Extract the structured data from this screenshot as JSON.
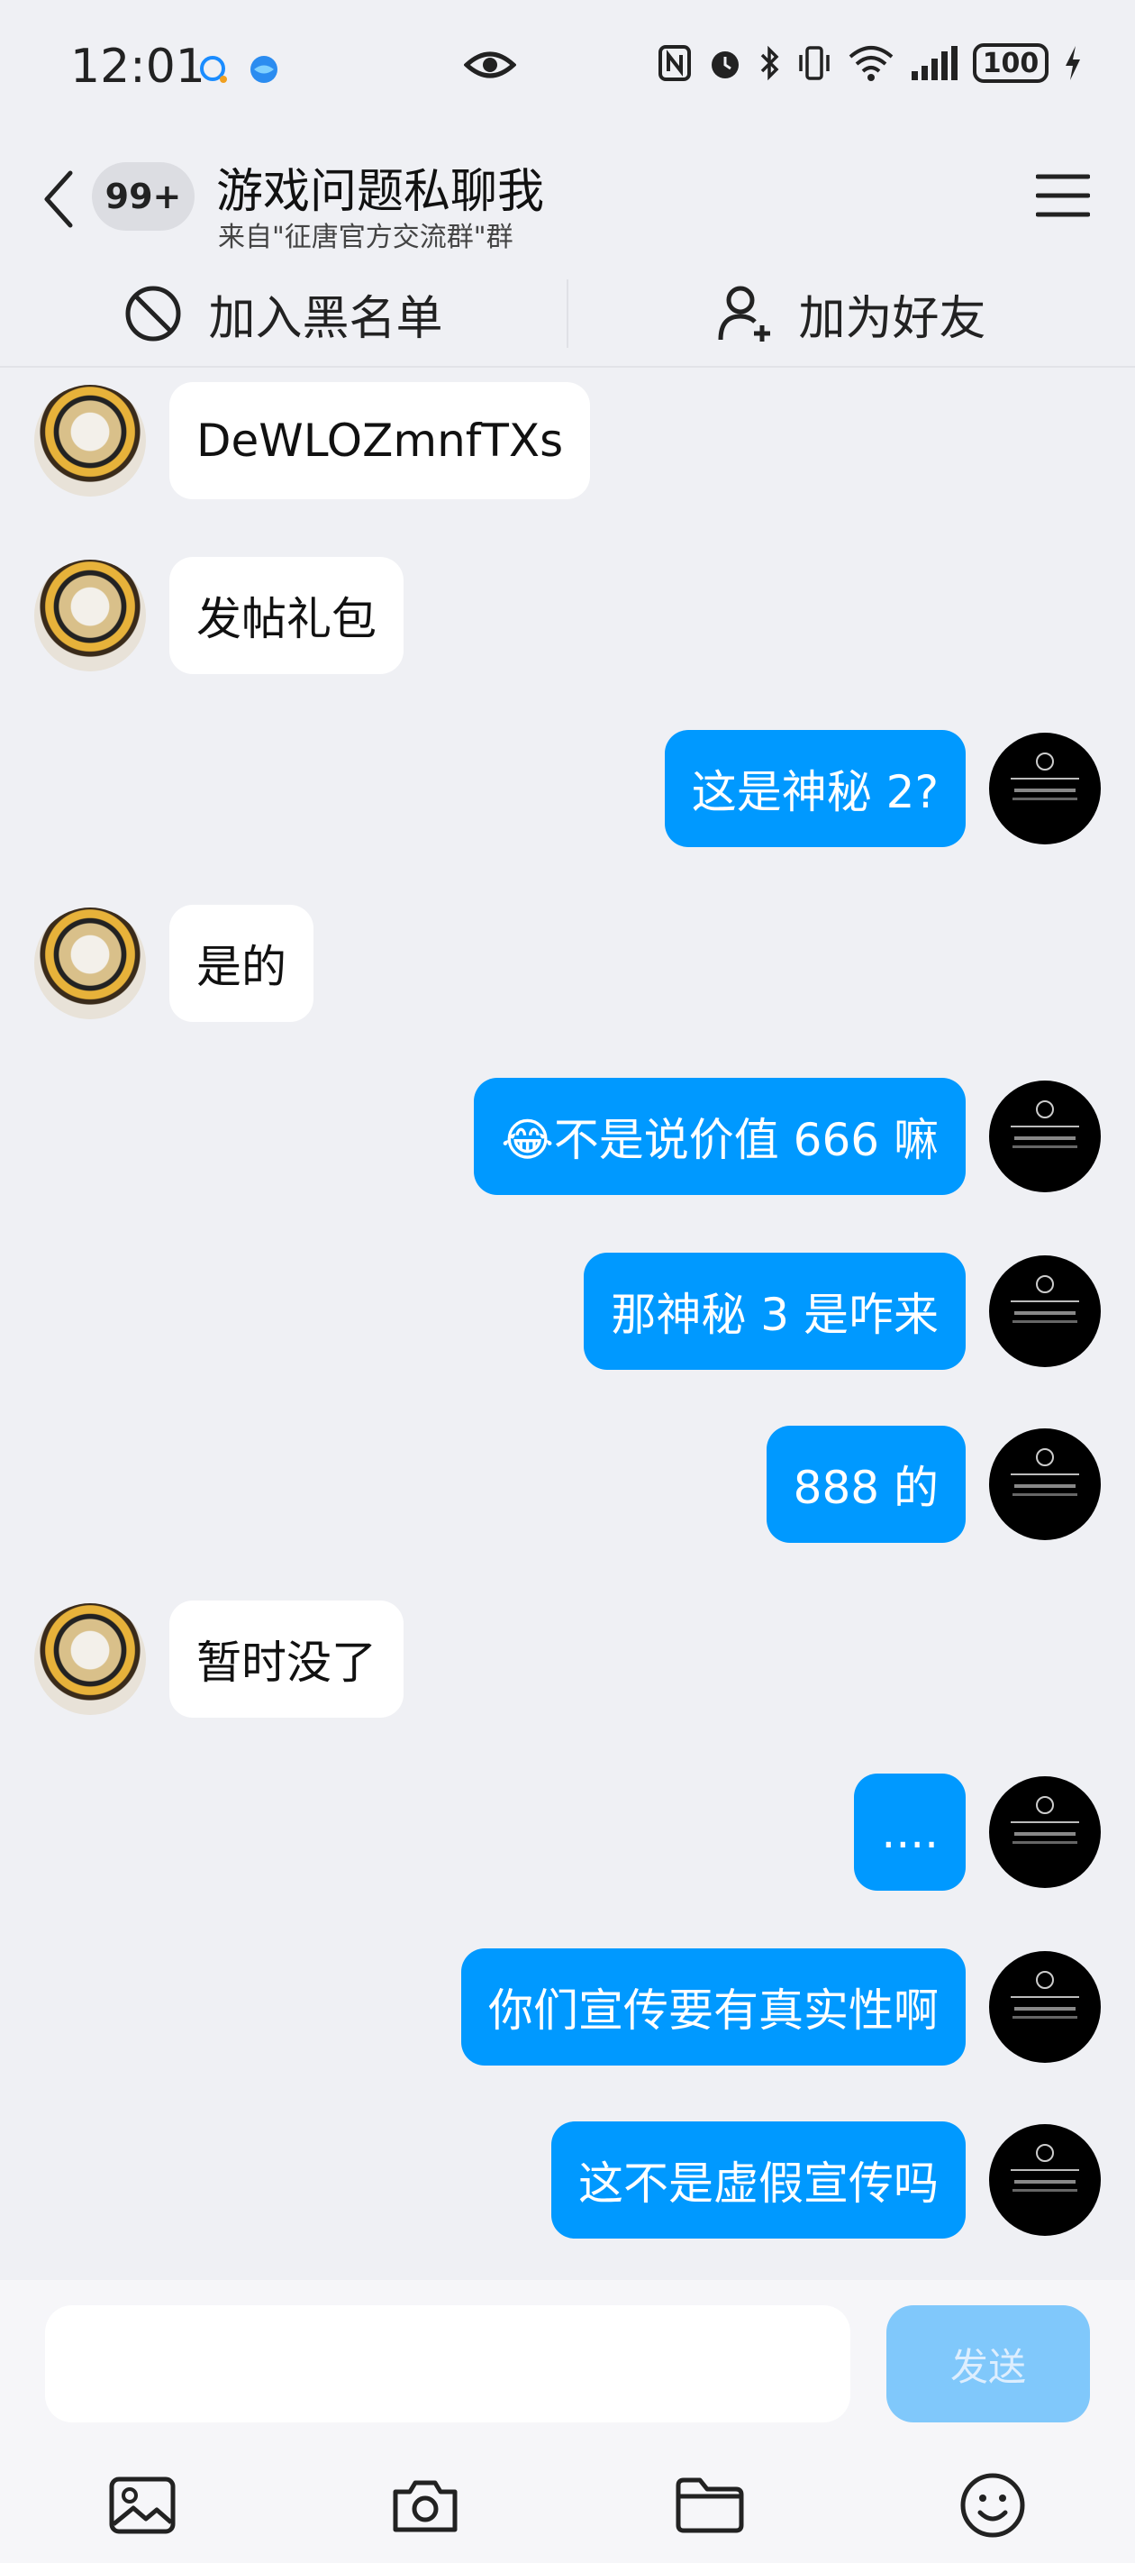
{
  "status_bar": {
    "time": "12:01",
    "battery": "100"
  },
  "header": {
    "unread_count": "99+",
    "title": "游戏问题私聊我",
    "subtitle": "来自\"征唐官方交流群\"群"
  },
  "actions": {
    "block_label": "加入黑名单",
    "add_friend_label": "加为好友"
  },
  "messages": [
    {
      "side": "in",
      "text": "DeWLOZmnfTXs"
    },
    {
      "side": "in",
      "text": "发帖礼包"
    },
    {
      "side": "out",
      "text": "这是神秘 2?"
    },
    {
      "side": "in",
      "text": "是的"
    },
    {
      "side": "out",
      "text": "😂不是说价值 666 嘛"
    },
    {
      "side": "out",
      "text": "那神秘 3 是咋来"
    },
    {
      "side": "out",
      "text": "888 的"
    },
    {
      "side": "in",
      "text": "暂时没了"
    },
    {
      "side": "out",
      "text": "...."
    },
    {
      "side": "out",
      "text": "你们宣传要有真实性啊"
    },
    {
      "side": "out",
      "text": "这不是虚假宣传吗"
    }
  ],
  "composer": {
    "input_value": "",
    "send_label": "发送"
  },
  "colors": {
    "outgoing_bubble": "#0099ff",
    "incoming_bubble": "#ffffff",
    "background": "#eff0f4",
    "send_disabled": "#80c8fb"
  },
  "icons": [
    "back-icon",
    "menu-icon",
    "block-icon",
    "add-friend-icon",
    "eye-icon",
    "image-icon",
    "camera-icon",
    "folder-icon",
    "emoji-icon"
  ]
}
